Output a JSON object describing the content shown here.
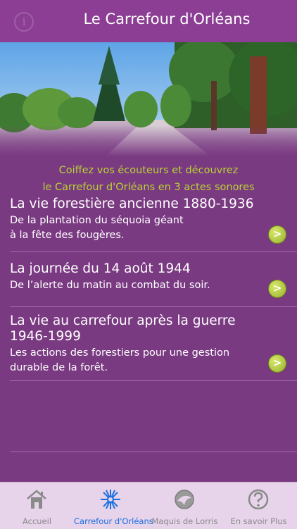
{
  "header": {
    "title": "Le Carrefour d'Orléans",
    "info_icon": "info-icon",
    "info_glyph": "i"
  },
  "intro": {
    "line1": "Coiffez vos écouteurs et découvrez",
    "line2": "le Carrefour d'Orléans en 3 actes sonores"
  },
  "items": [
    {
      "title": "La vie forestière ancienne 1880-1936",
      "sub1": "De la plantation du séquoia géant",
      "sub2": "à la fête des fougères.",
      "arrow": ">"
    },
    {
      "title": "La journée du 14 août 1944",
      "sub1": "De l’alerte du matin au combat du soir.",
      "arrow": ">"
    },
    {
      "title": "La vie au carrefour après  la guerre",
      "title2": "1946-1999",
      "sub1": "Les actions des forestiers pour une gestion",
      "sub2": "durable de la forêt.",
      "arrow": ">"
    }
  ],
  "tabs": [
    {
      "label": "Accueil",
      "icon": "house-icon"
    },
    {
      "label": "Carrefour d'Orléans",
      "icon": "starburst-icon",
      "active": true
    },
    {
      "label": "Maquis de Lorris",
      "icon": "emblem-icon"
    },
    {
      "label": "En savoir Plus",
      "icon": "question-icon"
    }
  ],
  "colors": {
    "background": "#7a3a82",
    "accent": "#b7d431",
    "active_tab": "#1a6fe0"
  }
}
